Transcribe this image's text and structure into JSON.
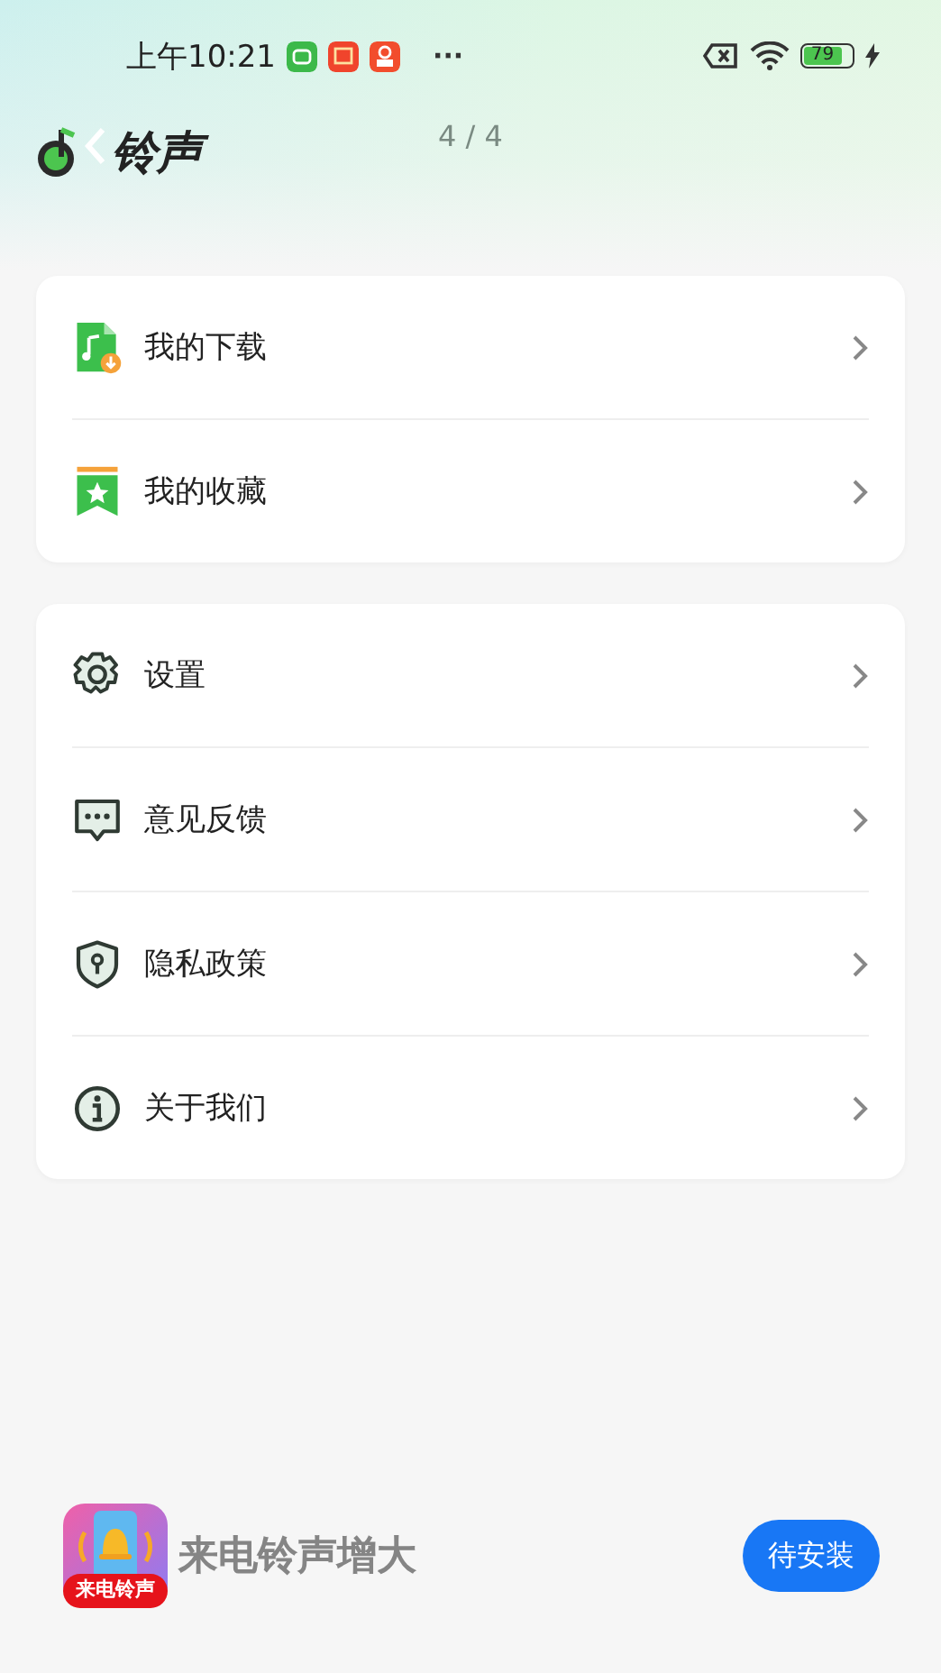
{
  "status_bar": {
    "time": "上午10:21",
    "more": "···",
    "battery": "79"
  },
  "header": {
    "title": "铃声",
    "counter": "4 / 4"
  },
  "groups": [
    {
      "items": [
        {
          "label": "我的下载",
          "kind": "download"
        },
        {
          "label": "我的收藏",
          "kind": "favorite"
        }
      ]
    },
    {
      "items": [
        {
          "label": "设置",
          "kind": "settings"
        },
        {
          "label": "意见反馈",
          "kind": "feedback"
        },
        {
          "label": "隐私政策",
          "kind": "privacy"
        },
        {
          "label": "关于我们",
          "kind": "about"
        }
      ]
    }
  ],
  "promo": {
    "icon_label": "来电铃声",
    "app_name": "来电铃声增大",
    "button": "待安装"
  }
}
